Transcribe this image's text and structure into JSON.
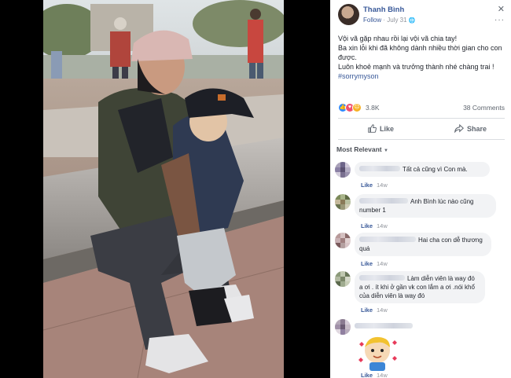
{
  "post": {
    "author": "Thanh Bình",
    "follow": "Follow",
    "separator": " · ",
    "date": "July 31",
    "globe": "🌐",
    "close": "✕",
    "more": "···",
    "lines": [
      "Vội vã gặp nhau rồi lại vội vã chia tay!",
      "Ba xin lỗi khi đã không dành nhiều thời gian cho con được.",
      "Luôn khoẻ mạnh và trưởng thành nhé chàng trai !"
    ],
    "hashtag": "#sorrymyson"
  },
  "reactions": {
    "like_icon": "👍",
    "love_icon": "♥",
    "sad_icon": "☹",
    "count": "3.8K",
    "comments": "38 Comments"
  },
  "actions": {
    "like": "Like",
    "share": "Share"
  },
  "sort": {
    "label": "Most Relevant",
    "caret": "▼"
  },
  "comments": [
    {
      "text": "Tất cả cũng vì Con mà.",
      "like": "Like",
      "time": "14w"
    },
    {
      "text": "Anh Bình lúc nào cũng number 1",
      "like": "Like",
      "time": "14w"
    },
    {
      "text": "Hai cha con dễ thương quá",
      "like": "Like",
      "time": "14w"
    },
    {
      "text": "Làm diễn viên là way đó a ơi . ít khi ở gần vk con lắm a ơi .nói khổ của diễn viên là way đó",
      "like": "Like",
      "time": "14w"
    },
    {
      "text": "",
      "like": "Like",
      "time": "14w"
    }
  ],
  "colors": {
    "link": "#385898",
    "muted": "#90949c",
    "bubble": "#f2f3f5",
    "like_blue": "#2e89ff",
    "love_red": "#f0506e",
    "sad_yellow": "#f7b125"
  }
}
